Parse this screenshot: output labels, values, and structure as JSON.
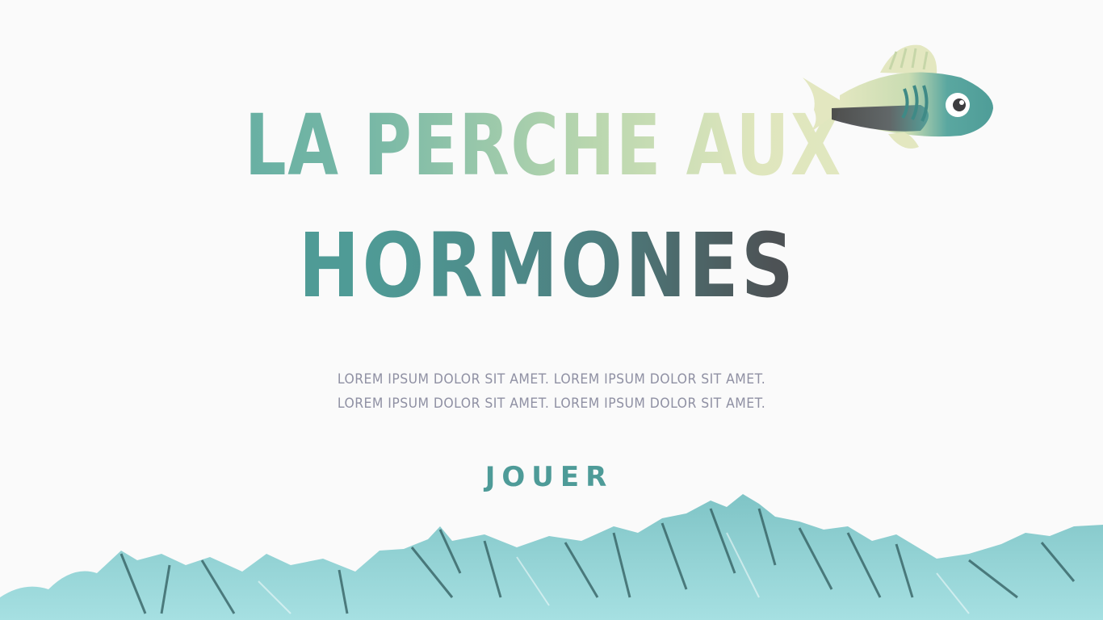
{
  "game": {
    "title_line_1": "LA PERCHE AUX",
    "title_line_2": "HORMONES",
    "description_line_1": "LOREM IPSUM DOLOR SIT AMET. LOREM IPSUM DOLOR SIT AMET.",
    "description_line_2": "LOREM IPSUM DOLOR SIT AMET. LOREM IPSUM DOLOR SIT AMET.",
    "play_label": "JOUER"
  },
  "decorations": {
    "mascot": "fish-illustration",
    "footer": "water-brush-strokes"
  },
  "colors": {
    "background": "#fafafa",
    "teal": "#57a7a0",
    "pale_green": "#e4e9c3",
    "dark_grey": "#4f4f52",
    "subtitle": "#8f90a3",
    "water": "#8fd1d4"
  }
}
